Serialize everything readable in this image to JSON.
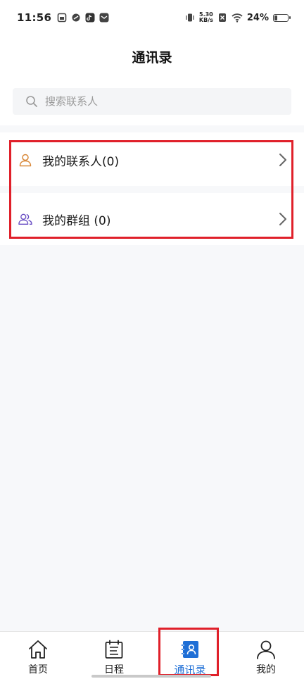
{
  "status_bar": {
    "time": "11:56",
    "net_speed_value": "5.30",
    "net_speed_unit": "KB/s",
    "battery": "24%",
    "battery_level": 0.24
  },
  "header": {
    "title": "通讯录"
  },
  "search": {
    "placeholder": "搜索联系人"
  },
  "list": {
    "contacts_label": "我的联系人(0)",
    "groups_label": "我的群组 (0)"
  },
  "colors": {
    "contacts_icon": "#d9893a",
    "groups_icon": "#6a4fc4",
    "accent": "#1f6fd6",
    "highlight": "#e0202a"
  },
  "tabs": [
    {
      "label": "首页",
      "icon": "home-icon"
    },
    {
      "label": "日程",
      "icon": "schedule-icon"
    },
    {
      "label": "通讯录",
      "icon": "contacts-book-icon",
      "active": true
    },
    {
      "label": "我的",
      "icon": "profile-icon"
    }
  ]
}
